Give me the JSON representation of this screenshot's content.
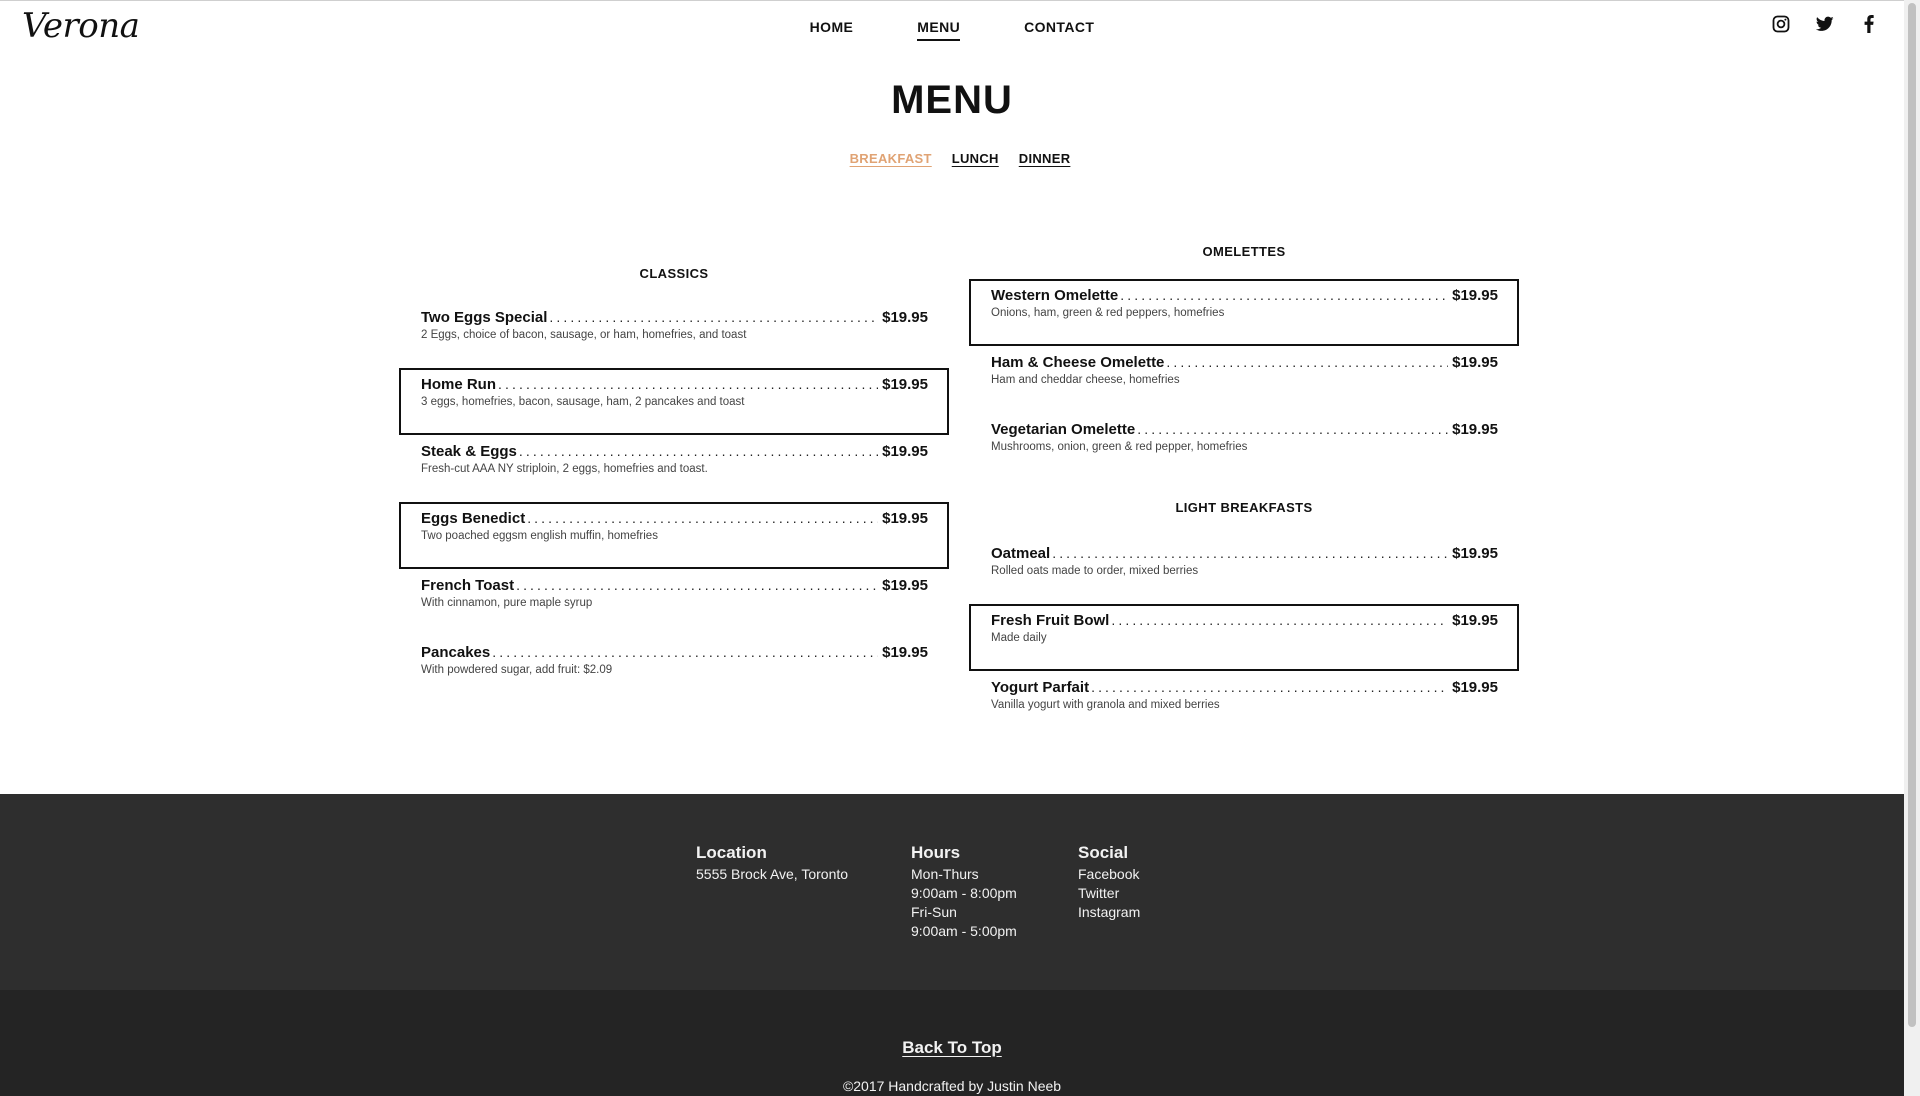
{
  "brand": {
    "logo": "Verona"
  },
  "nav": {
    "items": [
      {
        "label": "HOME",
        "active": false
      },
      {
        "label": "MENU",
        "active": true
      },
      {
        "label": "CONTACT",
        "active": false
      }
    ]
  },
  "social_icons": [
    "instagram-icon",
    "twitter-icon",
    "facebook-icon"
  ],
  "page": {
    "title": "MENU"
  },
  "menu_tabs": [
    {
      "label": "BREAKFAST",
      "active": true,
      "color": "#e0a374"
    },
    {
      "label": "LUNCH",
      "active": false
    },
    {
      "label": "DINNER",
      "active": false
    }
  ],
  "sections": {
    "classics": {
      "title": "CLASSICS",
      "items": [
        {
          "name": "Two Eggs Special",
          "price": "$19.95",
          "desc": "2 Eggs, choice of bacon, sausage, or ham, homefries, and toast",
          "highlight": false
        },
        {
          "name": "Home Run",
          "price": "$19.95",
          "desc": "3 eggs, homefries, bacon, sausage, ham, 2 pancakes and toast",
          "highlight": true
        },
        {
          "name": "Steak & Eggs",
          "price": "$19.95",
          "desc": "Fresh-cut AAA NY striploin, 2 eggs, homefries and toast.",
          "highlight": false
        },
        {
          "name": "Eggs Benedict",
          "price": "$19.95",
          "desc": "Two poached eggsm english muffin, homefries",
          "highlight": true
        },
        {
          "name": "French Toast",
          "price": "$19.95",
          "desc": "With cinnamon, pure maple syrup",
          "highlight": false
        },
        {
          "name": "Pancakes",
          "price": "$19.95",
          "desc": "With powdered sugar, add fruit: $2.09",
          "highlight": false
        }
      ]
    },
    "omelettes": {
      "title": "OMELETTES",
      "items": [
        {
          "name": "Western Omelette",
          "price": "$19.95",
          "desc": "Onions, ham, green & red peppers, homefries",
          "highlight": true
        },
        {
          "name": "Ham & Cheese Omelette",
          "price": "$19.95",
          "desc": "Ham and cheddar cheese, homefries",
          "highlight": false
        },
        {
          "name": "Vegetarian Omelette",
          "price": "$19.95",
          "desc": "Mushrooms, onion, green & red pepper, homefries",
          "highlight": false
        }
      ]
    },
    "light_breakfasts": {
      "title": "LIGHT BREAKFASTS",
      "items": [
        {
          "name": "Oatmeal",
          "price": "$19.95",
          "desc": "Rolled oats made to order, mixed berries",
          "highlight": false
        },
        {
          "name": "Fresh Fruit Bowl",
          "price": "$19.95",
          "desc": "Made daily",
          "highlight": true
        },
        {
          "name": "Yogurt Parfait",
          "price": "$19.95",
          "desc": "Vanilla yogurt with granola and mixed berries",
          "highlight": false
        }
      ]
    }
  },
  "footer": {
    "location": {
      "title": "Location",
      "address": "5555 Brock Ave, Toronto"
    },
    "hours": {
      "title": "Hours",
      "lines": [
        "Mon-Thurs",
        "9:00am - 8:00pm",
        "Fri-Sun",
        "9:00am - 5:00pm"
      ]
    },
    "social": {
      "title": "Social",
      "links": [
        "Facebook",
        "Twitter",
        "Instagram"
      ]
    },
    "back_to_top": "Back To Top",
    "credit": "©2017 Handcrafted by Justin Neeb"
  },
  "colors": {
    "footer_bg": "#2e2e2e",
    "bottom_bar_bg": "#242424",
    "accent": "#e0a374"
  }
}
